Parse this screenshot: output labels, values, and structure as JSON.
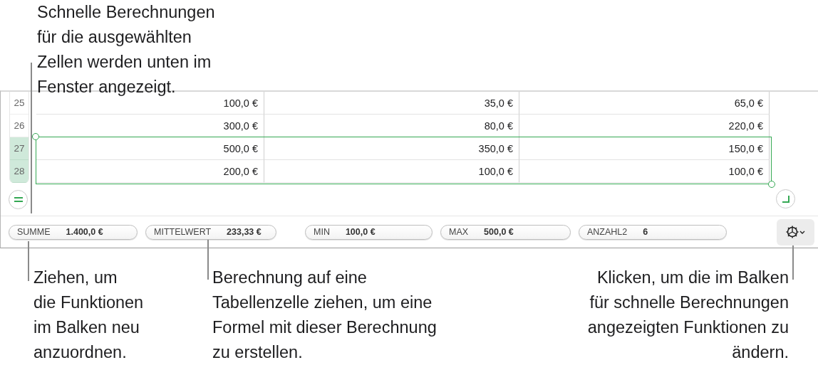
{
  "top_callout": [
    "Schnelle Berechnungen",
    "für die ausgewählten",
    "Zellen werden unten im",
    "Fenster angezeigt."
  ],
  "rows": [
    {
      "number": "25",
      "selected": false,
      "cells": [
        "100,0 €",
        "35,0 €",
        "65,0 €"
      ]
    },
    {
      "number": "26",
      "selected": false,
      "cells": [
        "300,0 €",
        "80,0 €",
        "220,0 €"
      ]
    },
    {
      "number": "27",
      "selected": true,
      "cells": [
        "500,0 €",
        "350,0 €",
        "150,0 €"
      ]
    },
    {
      "number": "28",
      "selected": true,
      "cells": [
        "200,0 €",
        "100,0 €",
        "100,0 €"
      ]
    }
  ],
  "summary": [
    {
      "label": "SUMME",
      "value": "1.400,0 €"
    },
    {
      "label": "MITTELWERT",
      "value": "233,33 €"
    },
    {
      "label": "MIN",
      "value": "100,0 €"
    },
    {
      "label": "MAX",
      "value": "500,0 €"
    },
    {
      "label": "ANZAHL2",
      "value": "6"
    }
  ],
  "bottom_callouts": [
    {
      "lines": [
        "Ziehen, um",
        "die Funktionen",
        "im Balken neu",
        "anzuordnen."
      ]
    },
    {
      "lines": [
        "Berechnung auf eine",
        "Tabellenzelle ziehen, um eine",
        "Formel mit dieser Berechnung",
        "zu erstellen."
      ]
    },
    {
      "lines": [
        "Klicken, um die im Balken",
        "für schnelle Berechnungen",
        "angezeigten Funktionen zu",
        "ändern."
      ]
    }
  ]
}
